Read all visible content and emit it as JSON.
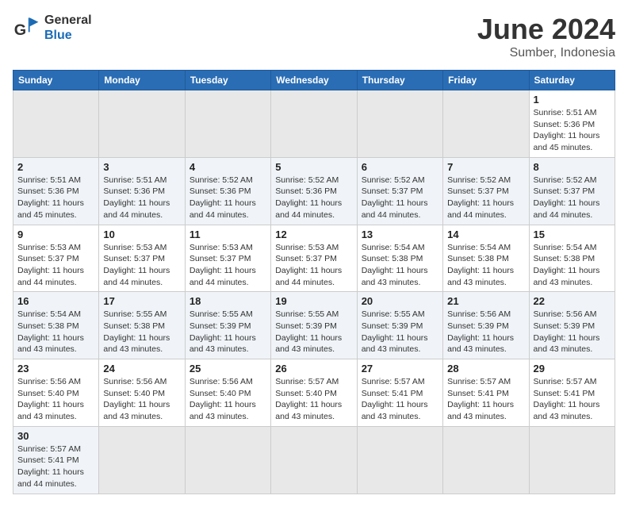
{
  "header": {
    "logo_general": "General",
    "logo_blue": "Blue",
    "month_title": "June 2024",
    "location": "Sumber, Indonesia"
  },
  "weekdays": [
    "Sunday",
    "Monday",
    "Tuesday",
    "Wednesday",
    "Thursday",
    "Friday",
    "Saturday"
  ],
  "weeks": [
    [
      {
        "day": "",
        "empty": true
      },
      {
        "day": "",
        "empty": true
      },
      {
        "day": "",
        "empty": true
      },
      {
        "day": "",
        "empty": true
      },
      {
        "day": "",
        "empty": true
      },
      {
        "day": "",
        "empty": true
      },
      {
        "day": "1",
        "sunrise": "5:51 AM",
        "sunset": "5:36 PM",
        "daylight": "11 hours and 45 minutes."
      }
    ],
    [
      {
        "day": "2",
        "sunrise": "5:51 AM",
        "sunset": "5:36 PM",
        "daylight": "11 hours and 45 minutes."
      },
      {
        "day": "3",
        "sunrise": "5:51 AM",
        "sunset": "5:36 PM",
        "daylight": "11 hours and 44 minutes."
      },
      {
        "day": "4",
        "sunrise": "5:52 AM",
        "sunset": "5:36 PM",
        "daylight": "11 hours and 44 minutes."
      },
      {
        "day": "5",
        "sunrise": "5:52 AM",
        "sunset": "5:36 PM",
        "daylight": "11 hours and 44 minutes."
      },
      {
        "day": "6",
        "sunrise": "5:52 AM",
        "sunset": "5:37 PM",
        "daylight": "11 hours and 44 minutes."
      },
      {
        "day": "7",
        "sunrise": "5:52 AM",
        "sunset": "5:37 PM",
        "daylight": "11 hours and 44 minutes."
      },
      {
        "day": "8",
        "sunrise": "5:52 AM",
        "sunset": "5:37 PM",
        "daylight": "11 hours and 44 minutes."
      }
    ],
    [
      {
        "day": "9",
        "sunrise": "5:53 AM",
        "sunset": "5:37 PM",
        "daylight": "11 hours and 44 minutes."
      },
      {
        "day": "10",
        "sunrise": "5:53 AM",
        "sunset": "5:37 PM",
        "daylight": "11 hours and 44 minutes."
      },
      {
        "day": "11",
        "sunrise": "5:53 AM",
        "sunset": "5:37 PM",
        "daylight": "11 hours and 44 minutes."
      },
      {
        "day": "12",
        "sunrise": "5:53 AM",
        "sunset": "5:37 PM",
        "daylight": "11 hours and 44 minutes."
      },
      {
        "day": "13",
        "sunrise": "5:54 AM",
        "sunset": "5:38 PM",
        "daylight": "11 hours and 43 minutes."
      },
      {
        "day": "14",
        "sunrise": "5:54 AM",
        "sunset": "5:38 PM",
        "daylight": "11 hours and 43 minutes."
      },
      {
        "day": "15",
        "sunrise": "5:54 AM",
        "sunset": "5:38 PM",
        "daylight": "11 hours and 43 minutes."
      }
    ],
    [
      {
        "day": "16",
        "sunrise": "5:54 AM",
        "sunset": "5:38 PM",
        "daylight": "11 hours and 43 minutes."
      },
      {
        "day": "17",
        "sunrise": "5:55 AM",
        "sunset": "5:38 PM",
        "daylight": "11 hours and 43 minutes."
      },
      {
        "day": "18",
        "sunrise": "5:55 AM",
        "sunset": "5:39 PM",
        "daylight": "11 hours and 43 minutes."
      },
      {
        "day": "19",
        "sunrise": "5:55 AM",
        "sunset": "5:39 PM",
        "daylight": "11 hours and 43 minutes."
      },
      {
        "day": "20",
        "sunrise": "5:55 AM",
        "sunset": "5:39 PM",
        "daylight": "11 hours and 43 minutes."
      },
      {
        "day": "21",
        "sunrise": "5:56 AM",
        "sunset": "5:39 PM",
        "daylight": "11 hours and 43 minutes."
      },
      {
        "day": "22",
        "sunrise": "5:56 AM",
        "sunset": "5:39 PM",
        "daylight": "11 hours and 43 minutes."
      }
    ],
    [
      {
        "day": "23",
        "sunrise": "5:56 AM",
        "sunset": "5:40 PM",
        "daylight": "11 hours and 43 minutes."
      },
      {
        "day": "24",
        "sunrise": "5:56 AM",
        "sunset": "5:40 PM",
        "daylight": "11 hours and 43 minutes."
      },
      {
        "day": "25",
        "sunrise": "5:56 AM",
        "sunset": "5:40 PM",
        "daylight": "11 hours and 43 minutes."
      },
      {
        "day": "26",
        "sunrise": "5:57 AM",
        "sunset": "5:40 PM",
        "daylight": "11 hours and 43 minutes."
      },
      {
        "day": "27",
        "sunrise": "5:57 AM",
        "sunset": "5:41 PM",
        "daylight": "11 hours and 43 minutes."
      },
      {
        "day": "28",
        "sunrise": "5:57 AM",
        "sunset": "5:41 PM",
        "daylight": "11 hours and 43 minutes."
      },
      {
        "day": "29",
        "sunrise": "5:57 AM",
        "sunset": "5:41 PM",
        "daylight": "11 hours and 43 minutes."
      }
    ],
    [
      {
        "day": "30",
        "sunrise": "5:57 AM",
        "sunset": "5:41 PM",
        "daylight": "11 hours and 44 minutes."
      },
      {
        "day": "",
        "empty": true
      },
      {
        "day": "",
        "empty": true
      },
      {
        "day": "",
        "empty": true
      },
      {
        "day": "",
        "empty": true
      },
      {
        "day": "",
        "empty": true
      },
      {
        "day": "",
        "empty": true
      }
    ]
  ],
  "labels": {
    "sunrise_prefix": "Sunrise: ",
    "sunset_prefix": "Sunset: ",
    "daylight_prefix": "Daylight: "
  }
}
